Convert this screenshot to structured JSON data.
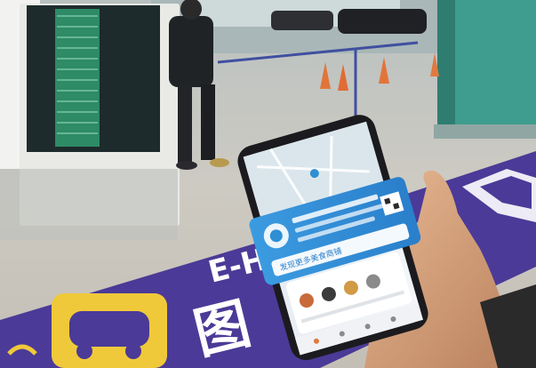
{
  "scene": {
    "floor_sign_text": "E-Ha",
    "floor_sign_glyph": "图",
    "phone_card_text": "发现更多美食商铺"
  },
  "colors": {
    "floor": "#c9c6bf",
    "floor_band": "#4b3a97",
    "sign_yellow": "#f0c93a",
    "pillar": "#3e9d8e",
    "board_green": "#3aa57a",
    "phone_dark": "#1b1b1f",
    "screen_blue": "#2f8fd4",
    "skin": "#d8a27c"
  }
}
